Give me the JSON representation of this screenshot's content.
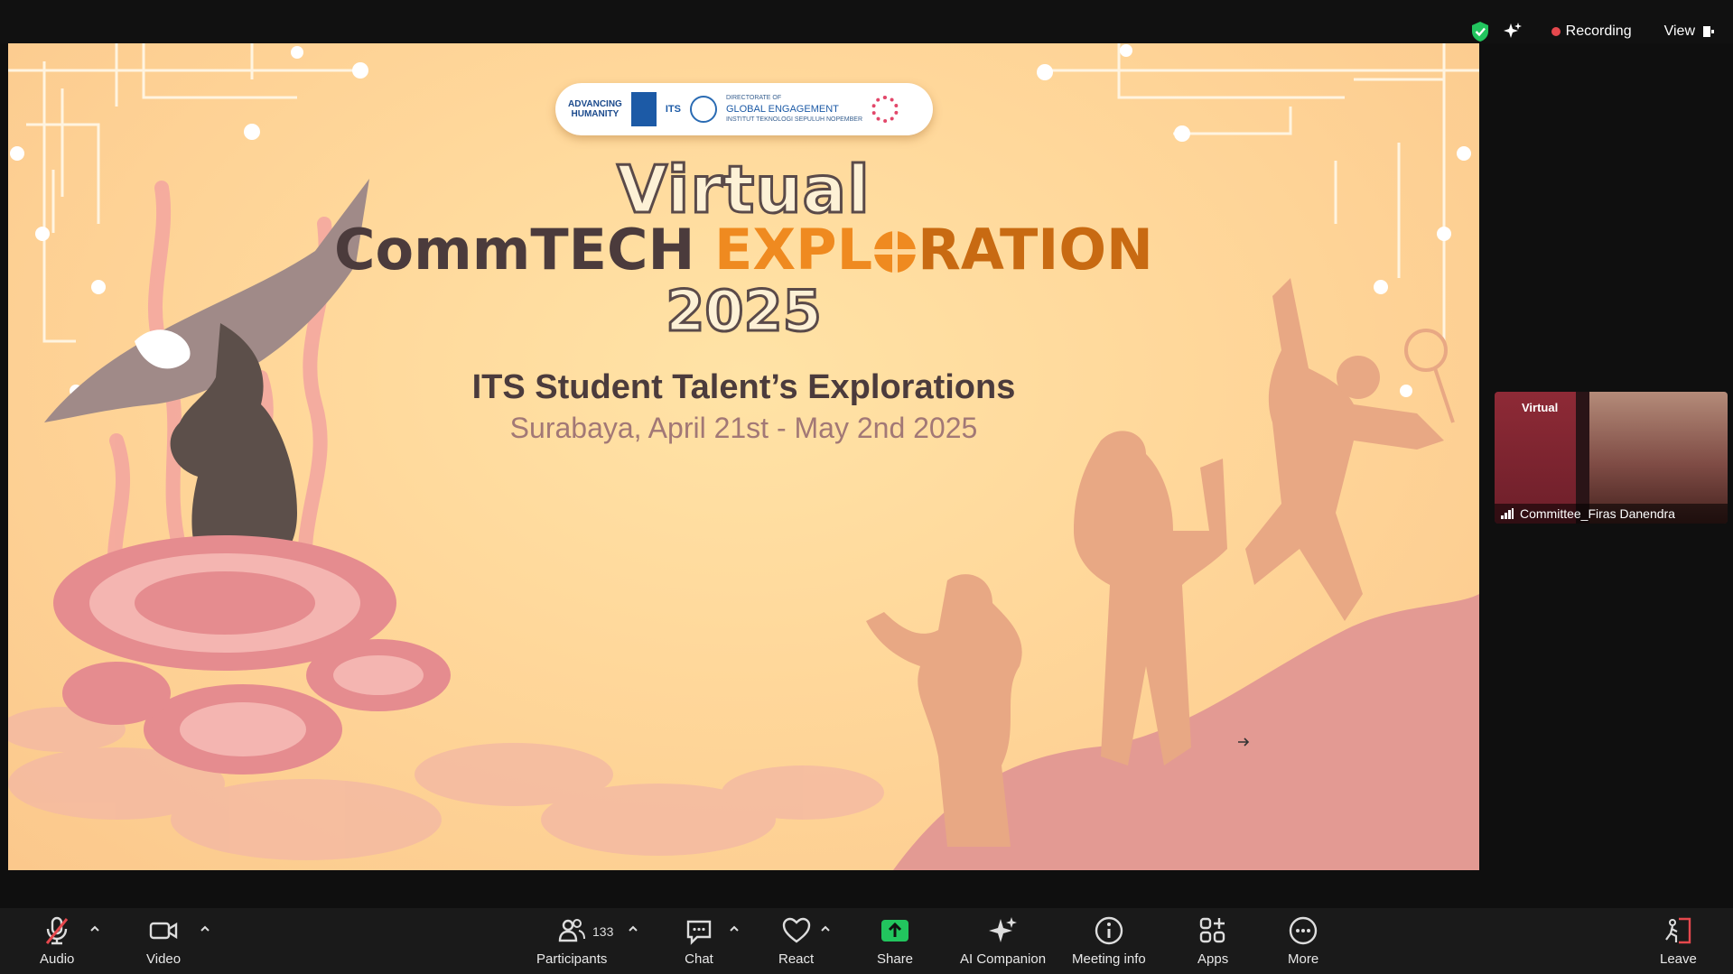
{
  "top_bar": {
    "recording_label": "Recording",
    "view_label": "View"
  },
  "slide": {
    "logos": {
      "advancing_line1": "ADVANCING",
      "advancing_line2": "HUMANITY",
      "its_text": "ITS",
      "directorate_small": "DIRECTORATE OF",
      "directorate_main": "GLOBAL ENGAGEMENT",
      "directorate_inst": "INSTITUT TEKNOLOGI SEPULUH NOPEMBER"
    },
    "title_virtual": "Virtual",
    "title_commtech": "CommTECH",
    "title_expl": "EXPL",
    "title_ration": "RATION",
    "title_year": "2025",
    "subtitle": "ITS Student Talent’s Explorations",
    "date_line": "Surabaya, April 21st -  May 2nd 2025"
  },
  "participant_tile": {
    "thumb_title": "Virtual",
    "name": "Committee_Firas Danendra"
  },
  "toolbar": {
    "audio": "Audio",
    "video": "Video",
    "participants": "Participants",
    "participants_count": "133",
    "chat": "Chat",
    "react": "React",
    "share": "Share",
    "ai_companion": "AI Companion",
    "meeting_info": "Meeting info",
    "apps": "Apps",
    "more": "More",
    "leave": "Leave"
  },
  "colors": {
    "share_green": "#22c55e",
    "recording_red": "#e5484d",
    "shield_green": "#22c55e",
    "slide_title_orange": "#ef8a20",
    "slide_text_brown": "#4b3b3c"
  }
}
